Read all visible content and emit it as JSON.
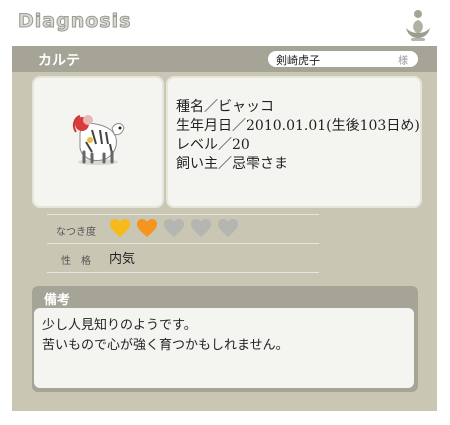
{
  "header": {
    "title": "Diagnosis",
    "logo_icon": "lotus-icon"
  },
  "card": {
    "title": "カルテ",
    "owner_name": "剣崎虎子",
    "owner_suffix": "様"
  },
  "pet": {
    "image_icon": "white-tiger-pet-icon",
    "info": {
      "species": "種名／ビャッコ",
      "birthday": "生年月日／2010.01.01(生後103日め)",
      "level": "レベル／20",
      "owner": "飼い主／忌雫さま"
    }
  },
  "attributes": {
    "affection_label": "なつき度",
    "affection_value": 2,
    "affection_max": 5,
    "personality_label": "性　格",
    "personality_value": "内気"
  },
  "memo": {
    "title": "備考",
    "line1": "少し人見知りのようです。",
    "line2": "苦いもので心が強く育つかもしれません。"
  },
  "colors": {
    "panel": "#c9c7b4",
    "header_bar": "#a5a497",
    "heart_on_1": "#f6bb1a",
    "heart_on_2": "#f4961d",
    "heart_off": "#b5b5b1"
  }
}
